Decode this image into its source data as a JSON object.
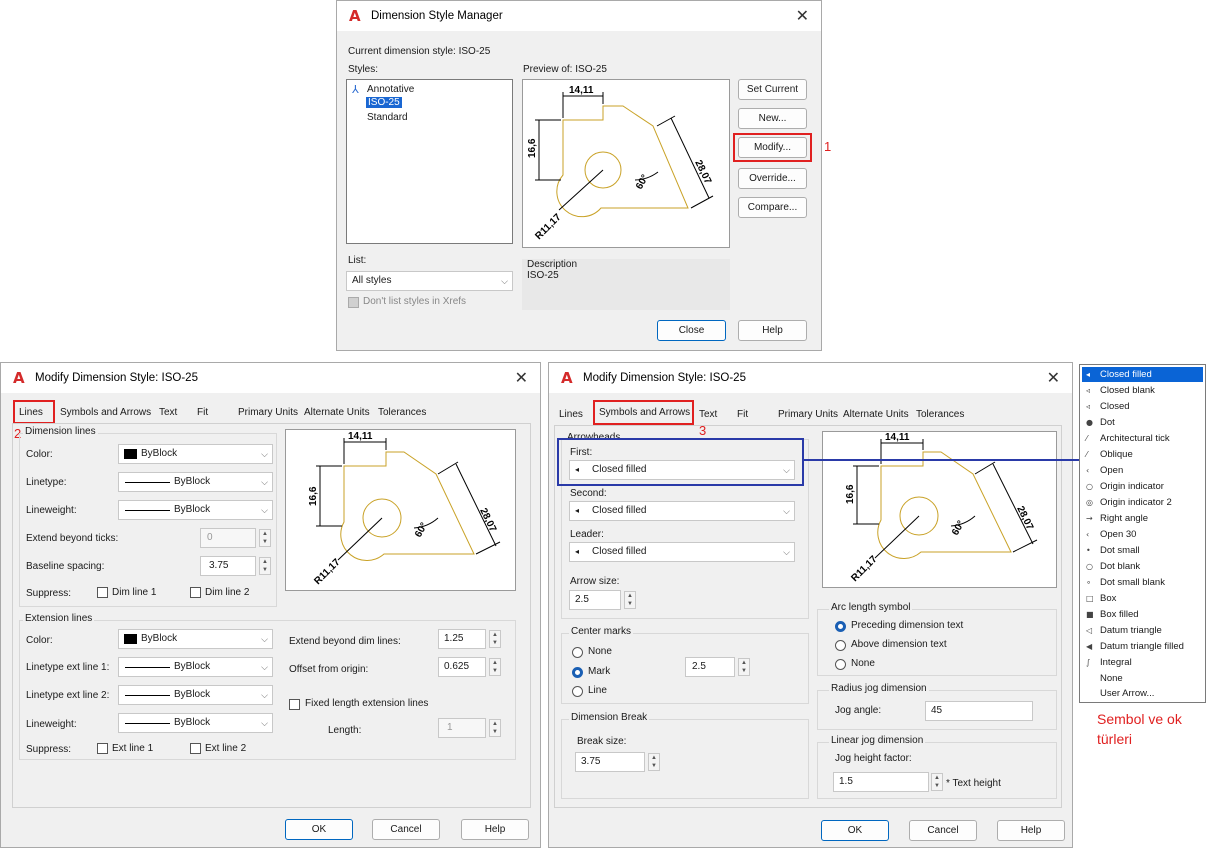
{
  "dsm": {
    "title": "Dimension Style Manager",
    "current_style": "Current dimension style: ISO-25",
    "styles_label": "Styles:",
    "styles": [
      "Annotative",
      "ISO-25",
      "Standard"
    ],
    "preview_label": "Preview of: ISO-25",
    "buttons": {
      "set_current": "Set Current",
      "new": "New...",
      "modify": "Modify...",
      "override": "Override...",
      "compare": "Compare..."
    },
    "list_label": "List:",
    "list_value": "All styles",
    "dont_list": "Don't list styles in Xrefs",
    "description_label": "Description",
    "description_value": "ISO-25",
    "close": "Close",
    "help": "Help",
    "step": "1"
  },
  "preview": {
    "dim_top": "14,11",
    "dim_left": "16,6",
    "dim_diag": "28,07",
    "angle": "60°",
    "radius": "R11,17"
  },
  "mod_lines": {
    "title": "Modify Dimension Style: ISO-25",
    "tabs": [
      "Lines",
      "Symbols and Arrows",
      "Text",
      "Fit",
      "Primary Units",
      "Alternate Units",
      "Tolerances"
    ],
    "step": "2",
    "dim_lines": {
      "group": "Dimension lines",
      "color_label": "Color:",
      "color_value": "ByBlock",
      "linetype_label": "Linetype:",
      "linetype_value": "ByBlock",
      "lineweight_label": "Lineweight:",
      "lineweight_value": "ByBlock",
      "extend_label": "Extend beyond ticks:",
      "extend_value": "0",
      "baseline_label": "Baseline spacing:",
      "baseline_value": "3.75",
      "suppress_label": "Suppress:",
      "dim1": "Dim line 1",
      "dim2": "Dim line 2"
    },
    "ext_lines": {
      "group": "Extension lines",
      "color_label": "Color:",
      "color_value": "ByBlock",
      "lt1_label": "Linetype ext line 1:",
      "lt1_value": "ByBlock",
      "lt2_label": "Linetype ext line 2:",
      "lt2_value": "ByBlock",
      "lw_label": "Lineweight:",
      "lw_value": "ByBlock",
      "suppress_label": "Suppress:",
      "ext1": "Ext line 1",
      "ext2": "Ext line 2",
      "extend_label": "Extend beyond dim lines:",
      "extend_value": "1.25",
      "offset_label": "Offset from origin:",
      "offset_value": "0.625",
      "fixed_label": "Fixed length extension lines",
      "length_label": "Length:",
      "length_value": "1"
    },
    "ok": "OK",
    "cancel": "Cancel",
    "help": "Help"
  },
  "mod_sym": {
    "title": "Modify Dimension Style: ISO-25",
    "tabs": [
      "Lines",
      "Symbols and Arrows",
      "Text",
      "Fit",
      "Primary Units",
      "Alternate Units",
      "Tolerances"
    ],
    "step": "3",
    "arrowheads": {
      "group": "Arrowheads",
      "first_label": "First:",
      "first_value": "Closed filled",
      "second_label": "Second:",
      "second_value": "Closed filled",
      "leader_label": "Leader:",
      "leader_value": "Closed filled",
      "size_label": "Arrow size:",
      "size_value": "2.5"
    },
    "center": {
      "group": "Center marks",
      "none": "None",
      "mark": "Mark",
      "line": "Line",
      "value": "2.5"
    },
    "dimbreak": {
      "group": "Dimension Break",
      "size_label": "Break size:",
      "size_value": "3.75"
    },
    "arc": {
      "group": "Arc length symbol",
      "preceding": "Preceding dimension text",
      "above": "Above dimension text",
      "none": "None"
    },
    "radius_jog": {
      "group": "Radius jog dimension",
      "angle_label": "Jog angle:",
      "angle_value": "45"
    },
    "linear_jog": {
      "group": "Linear jog dimension",
      "height_label": "Jog height factor:",
      "height_value": "1.5",
      "suffix": "* Text height"
    },
    "ok": "OK",
    "cancel": "Cancel",
    "help": "Help"
  },
  "arrow_types": [
    {
      "label": "Closed filled",
      "icon": "◂"
    },
    {
      "label": "Closed blank",
      "icon": "◃"
    },
    {
      "label": "Closed",
      "icon": "◃"
    },
    {
      "label": "Dot",
      "icon": "●"
    },
    {
      "label": "Architectural tick",
      "icon": "⁄"
    },
    {
      "label": "Oblique",
      "icon": "⁄"
    },
    {
      "label": "Open",
      "icon": "‹"
    },
    {
      "label": "Origin indicator",
      "icon": "○"
    },
    {
      "label": "Origin indicator 2",
      "icon": "◎"
    },
    {
      "label": "Right angle",
      "icon": "→"
    },
    {
      "label": "Open 30",
      "icon": "‹"
    },
    {
      "label": "Dot small",
      "icon": "•"
    },
    {
      "label": "Dot blank",
      "icon": "○"
    },
    {
      "label": "Dot small blank",
      "icon": "∘"
    },
    {
      "label": "Box",
      "icon": "□"
    },
    {
      "label": "Box filled",
      "icon": "■"
    },
    {
      "label": "Datum triangle",
      "icon": "◁"
    },
    {
      "label": "Datum triangle filled",
      "icon": "◀"
    },
    {
      "label": "Integral",
      "icon": "∫"
    },
    {
      "label": "None",
      "icon": ""
    },
    {
      "label": "User Arrow...",
      "icon": ""
    }
  ],
  "caption": {
    "line1": "Sembol ve ok",
    "line2": "türleri"
  },
  "colors": {
    "accent_red": "#e02020",
    "accent_blue": "#2a3aa8",
    "select_blue": "#0a64d6",
    "drawing_gold": "#c9a227"
  }
}
